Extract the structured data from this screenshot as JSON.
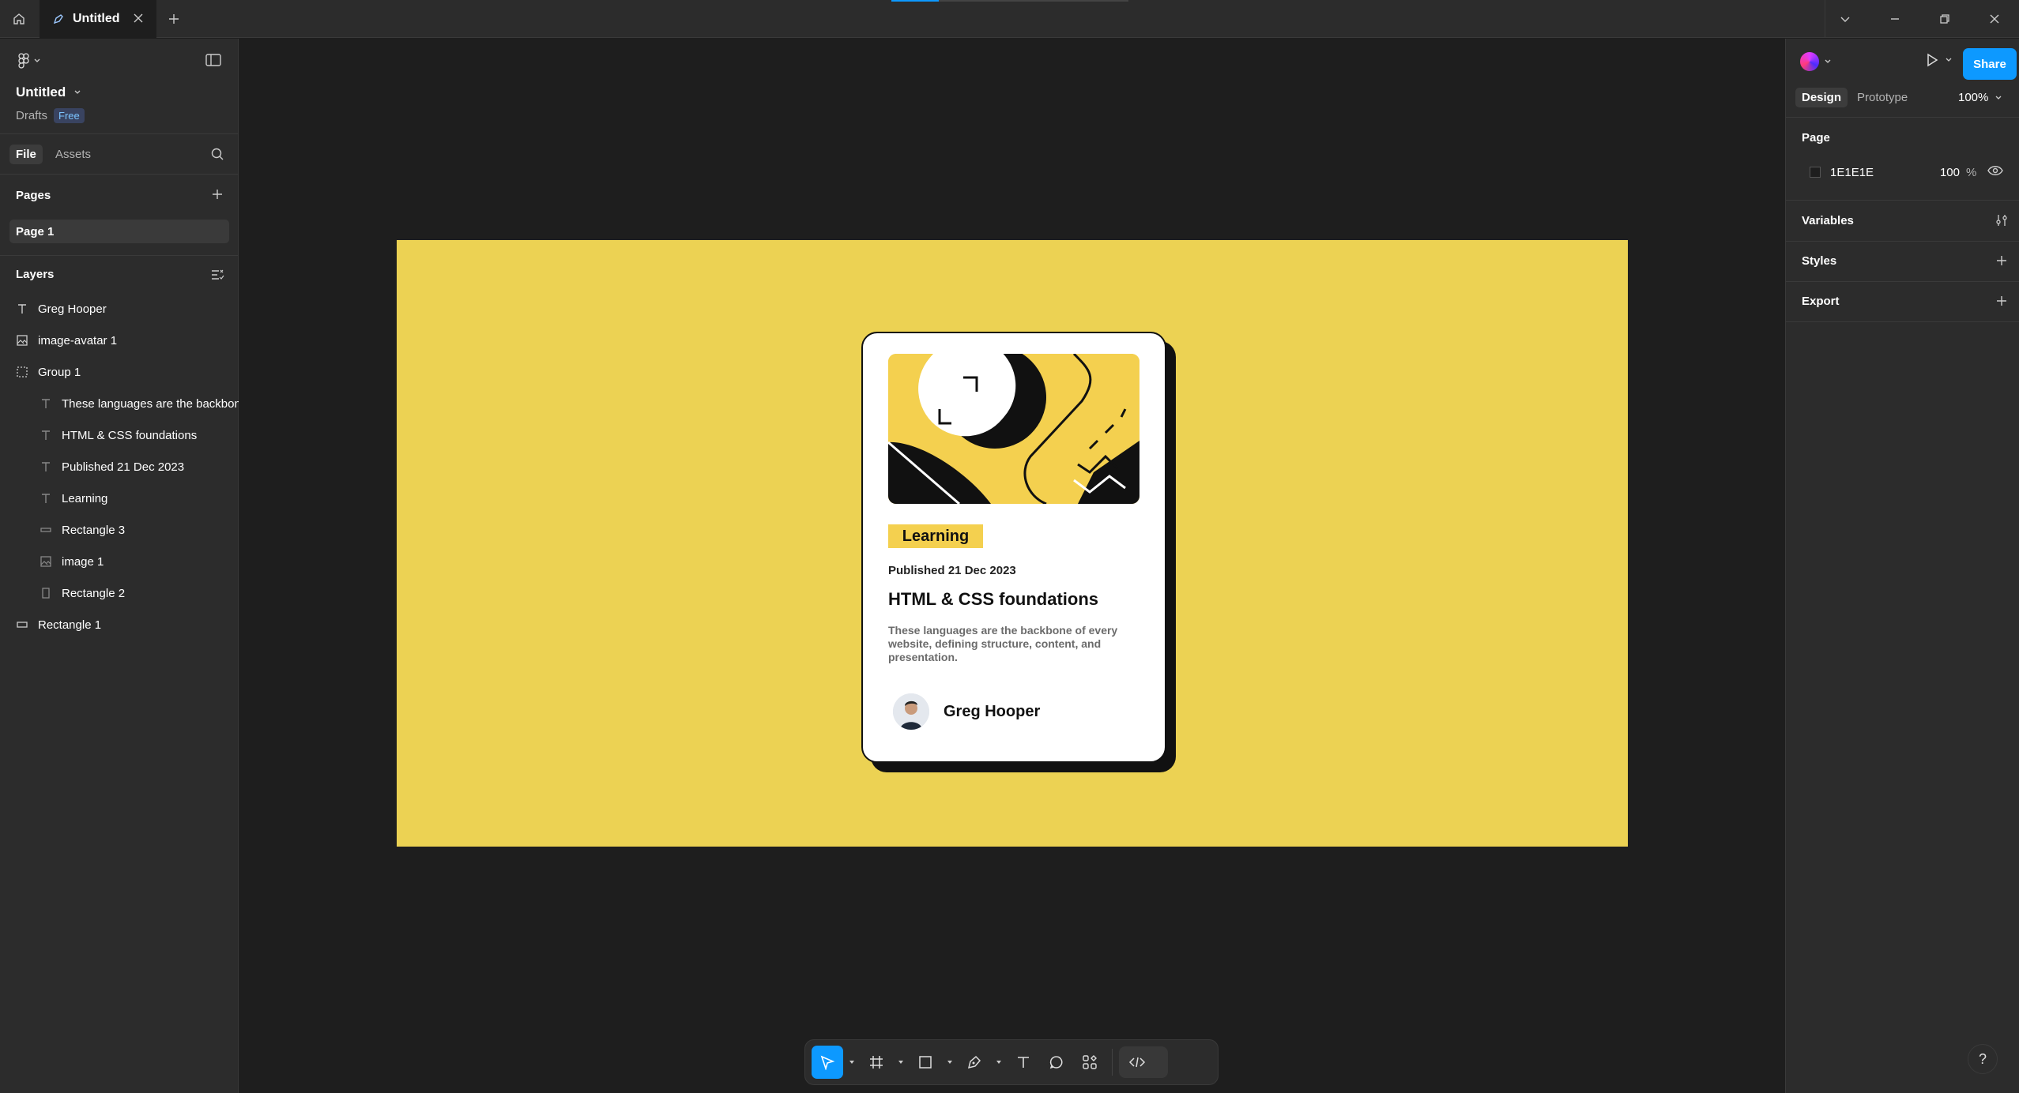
{
  "window": {
    "tab_title": "Untitled",
    "accent": "#0d99ff",
    "upload_progress": 0.2
  },
  "file": {
    "title": "Untitled",
    "location": "Drafts",
    "plan_badge": "Free"
  },
  "left_tabs": [
    "File",
    "Assets"
  ],
  "pages": {
    "heading": "Pages",
    "items": [
      "Page 1"
    ]
  },
  "layers": {
    "heading": "Layers",
    "items": [
      {
        "name": "Greg Hooper",
        "icon": "text-icon"
      },
      {
        "name": "image-avatar 1",
        "icon": "image-icon"
      },
      {
        "name": "Group 1",
        "icon": "group-icon"
      },
      {
        "name": "These languages are the backbon",
        "icon": "text-icon"
      },
      {
        "name": "HTML & CSS foundations",
        "icon": "text-icon"
      },
      {
        "name": "Published 21 Dec 2023",
        "icon": "text-icon"
      },
      {
        "name": "Learning",
        "icon": "text-icon"
      },
      {
        "name": "Rectangle 3",
        "icon": "rectangle-icon"
      },
      {
        "name": "image 1",
        "icon": "image-icon"
      },
      {
        "name": "Rectangle 2",
        "icon": "rectangle-icon"
      },
      {
        "name": "Rectangle 1",
        "icon": "rectangle-icon"
      }
    ]
  },
  "canvas": {
    "frame_color": "#ecd253",
    "card": {
      "tag": "Learning",
      "published": "Published 21 Dec 2023",
      "title": "HTML & CSS foundations",
      "description": "These languages are the backbone of every website, defining structure, content, and presentation.",
      "author": "Greg Hooper"
    }
  },
  "right_panel": {
    "share_label": "Share",
    "tabs": [
      "Design",
      "Prototype"
    ],
    "zoom": "100%",
    "page_section": "Page",
    "page_fill_hex": "1E1E1E",
    "page_fill_opacity": "100",
    "percent_sign": "%",
    "variables": "Variables",
    "styles": "Styles",
    "export": "Export"
  },
  "help_label": "?"
}
